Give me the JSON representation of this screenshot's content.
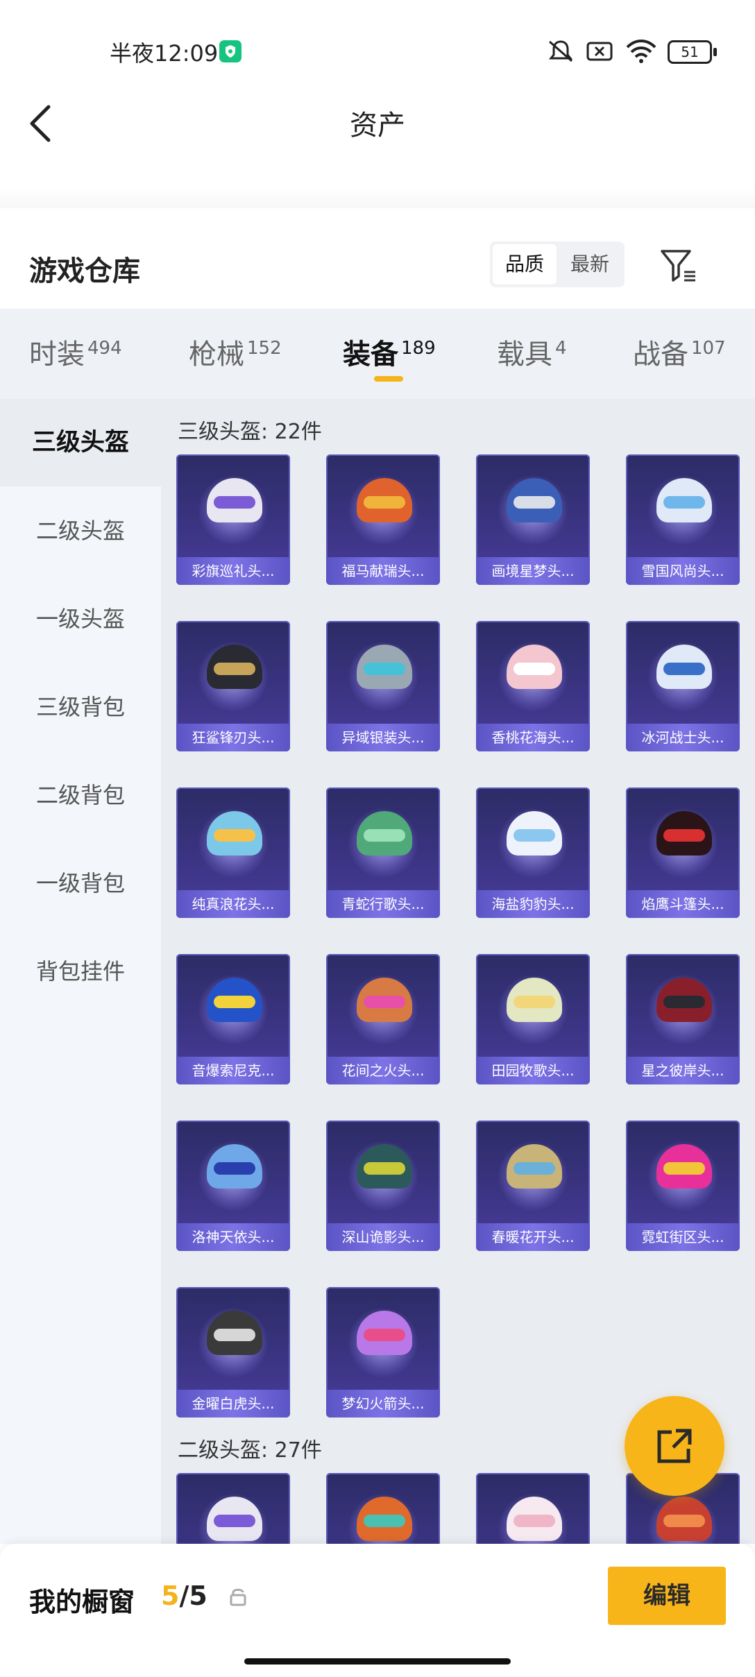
{
  "status_bar": {
    "time": "半夜12:09",
    "battery": "51"
  },
  "header": {
    "title": "资产"
  },
  "warehouse": {
    "title": "游戏仓库",
    "sort_options": [
      "品质",
      "最新"
    ],
    "active_sort": "品质"
  },
  "tabs": [
    {
      "label": "时装",
      "count": "494"
    },
    {
      "label": "枪械",
      "count": "152"
    },
    {
      "label": "装备",
      "count": "189",
      "active": true
    },
    {
      "label": "载具",
      "count": "4"
    },
    {
      "label": "战备",
      "count": "107"
    }
  ],
  "sidebar": {
    "items": [
      "三级头盔",
      "二级头盔",
      "一级头盔",
      "三级背包",
      "二级背包",
      "一级背包",
      "背包挂件"
    ],
    "active": "三级头盔"
  },
  "groups": [
    {
      "title": "三级头盔: 22件",
      "items": [
        {
          "name": "彩旗巡礼头...",
          "color": "#e8e6f0",
          "visor": "#7b5bd6"
        },
        {
          "name": "福马献瑞头...",
          "color": "#e0622c",
          "visor": "#f0b43a"
        },
        {
          "name": "画境星梦头...",
          "color": "#3b5fb6",
          "visor": "#d8dde8"
        },
        {
          "name": "雪国风尚头...",
          "color": "#dfe9f7",
          "visor": "#6fb6ea"
        },
        {
          "name": "狂鲨锋刃头...",
          "color": "#2a2a33",
          "visor": "#c8a45a"
        },
        {
          "name": "异域银装头...",
          "color": "#9aa8b4",
          "visor": "#46c2d8"
        },
        {
          "name": "香桃花海头...",
          "color": "#f4c6d0",
          "visor": "#ffffff"
        },
        {
          "name": "冰河战士头...",
          "color": "#dfe9f7",
          "visor": "#3a6fc8"
        },
        {
          "name": "纯真浪花头...",
          "color": "#7cc8e8",
          "visor": "#f6c14a"
        },
        {
          "name": "青蛇行歌头...",
          "color": "#4fa978",
          "visor": "#99e0b8"
        },
        {
          "name": "海盐豹豹头...",
          "color": "#eef3fb",
          "visor": "#8cc7f0"
        },
        {
          "name": "焰鹰斗篷头...",
          "color": "#2b1418",
          "visor": "#d83030"
        },
        {
          "name": "音爆索尼克...",
          "color": "#2452c8",
          "visor": "#f2d23b"
        },
        {
          "name": "花间之火头...",
          "color": "#d87a44",
          "visor": "#e84fa8"
        },
        {
          "name": "田园牧歌头...",
          "color": "#e3e7c2",
          "visor": "#f2d67a"
        },
        {
          "name": "星之彼岸头...",
          "color": "#8a1f2c",
          "visor": "#2a2a33"
        },
        {
          "name": "洛神天依头...",
          "color": "#6ea8e8",
          "visor": "#2a3fae"
        },
        {
          "name": "深山诡影头...",
          "color": "#2c5a5a",
          "visor": "#c8c83a"
        },
        {
          "name": "春暖花开头...",
          "color": "#c8b478",
          "visor": "#6ab0d8"
        },
        {
          "name": "霓虹街区头...",
          "color": "#e8309a",
          "visor": "#f2c43a"
        },
        {
          "name": "金曜白虎头...",
          "color": "#3a3a3a",
          "visor": "#d6d6d6"
        },
        {
          "name": "梦幻火箭头...",
          "color": "#b878e8",
          "visor": "#e84f8a"
        }
      ]
    },
    {
      "title": "二级头盔: 27件",
      "items": [
        {
          "name": "",
          "color": "#e8e6f0",
          "visor": "#7b5bd6"
        },
        {
          "name": "",
          "color": "#e06a2c",
          "visor": "#4ac0b0"
        },
        {
          "name": "",
          "color": "#f6eaf0",
          "visor": "#f0b6c8"
        },
        {
          "name": "",
          "color": "#c84030",
          "visor": "#f08a4a"
        }
      ]
    }
  ],
  "showcase": {
    "label": "我的橱窗",
    "current": "5",
    "total": "/5",
    "edit_label": "编辑"
  },
  "colors": {
    "accent": "#f7b51a",
    "card_bg": "#3b3483"
  }
}
